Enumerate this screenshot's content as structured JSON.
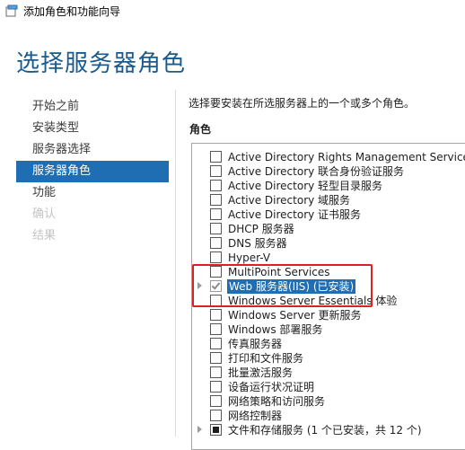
{
  "window": {
    "title": "添加角色和功能向导"
  },
  "page": {
    "title": "选择服务器角色"
  },
  "nav": {
    "items": [
      {
        "label": "开始之前",
        "state": "normal"
      },
      {
        "label": "安装类型",
        "state": "normal"
      },
      {
        "label": "服务器选择",
        "state": "normal"
      },
      {
        "label": "服务器角色",
        "state": "selected"
      },
      {
        "label": "功能",
        "state": "normal"
      },
      {
        "label": "确认",
        "state": "disabled"
      },
      {
        "label": "结果",
        "state": "disabled"
      }
    ]
  },
  "main": {
    "instruction": "选择要安装在所选服务器上的一个或多个角色。",
    "list_heading": "角色",
    "roles": [
      {
        "label": "Active Directory Rights Management Services",
        "checked": false,
        "expandable": false
      },
      {
        "label": "Active Directory 联合身份验证服务",
        "checked": false,
        "expandable": false
      },
      {
        "label": "Active Directory 轻型目录服务",
        "checked": false,
        "expandable": false
      },
      {
        "label": "Active Directory 域服务",
        "checked": false,
        "expandable": false
      },
      {
        "label": "Active Directory 证书服务",
        "checked": false,
        "expandable": false
      },
      {
        "label": "DHCP 服务器",
        "checked": false,
        "expandable": false
      },
      {
        "label": "DNS 服务器",
        "checked": false,
        "expandable": false
      },
      {
        "label": "Hyper-V",
        "checked": false,
        "expandable": false
      },
      {
        "label": "MultiPoint Services",
        "checked": false,
        "expandable": false
      },
      {
        "label": "Web 服务器(IIS) (已安装)",
        "checked": true,
        "expandable": true,
        "highlighted": true
      },
      {
        "label": "Windows Server Essentials 体验",
        "checked": false,
        "expandable": false
      },
      {
        "label": "Windows Server 更新服务",
        "checked": false,
        "expandable": false
      },
      {
        "label": "Windows 部署服务",
        "checked": false,
        "expandable": false
      },
      {
        "label": "传真服务器",
        "checked": false,
        "expandable": false
      },
      {
        "label": "打印和文件服务",
        "checked": false,
        "expandable": false
      },
      {
        "label": "批量激活服务",
        "checked": false,
        "expandable": false
      },
      {
        "label": "设备运行状况证明",
        "checked": false,
        "expandable": false
      },
      {
        "label": "网络策略和访问服务",
        "checked": false,
        "expandable": false
      },
      {
        "label": "网络控制器",
        "checked": false,
        "expandable": false
      },
      {
        "label": "文件和存储服务 (1 个已安装，共 12 个)",
        "checked": "partial",
        "expandable": true
      }
    ]
  },
  "colors": {
    "accent": "#1f6db3",
    "title": "#1a5b8f",
    "annotation": "#e0201e"
  }
}
